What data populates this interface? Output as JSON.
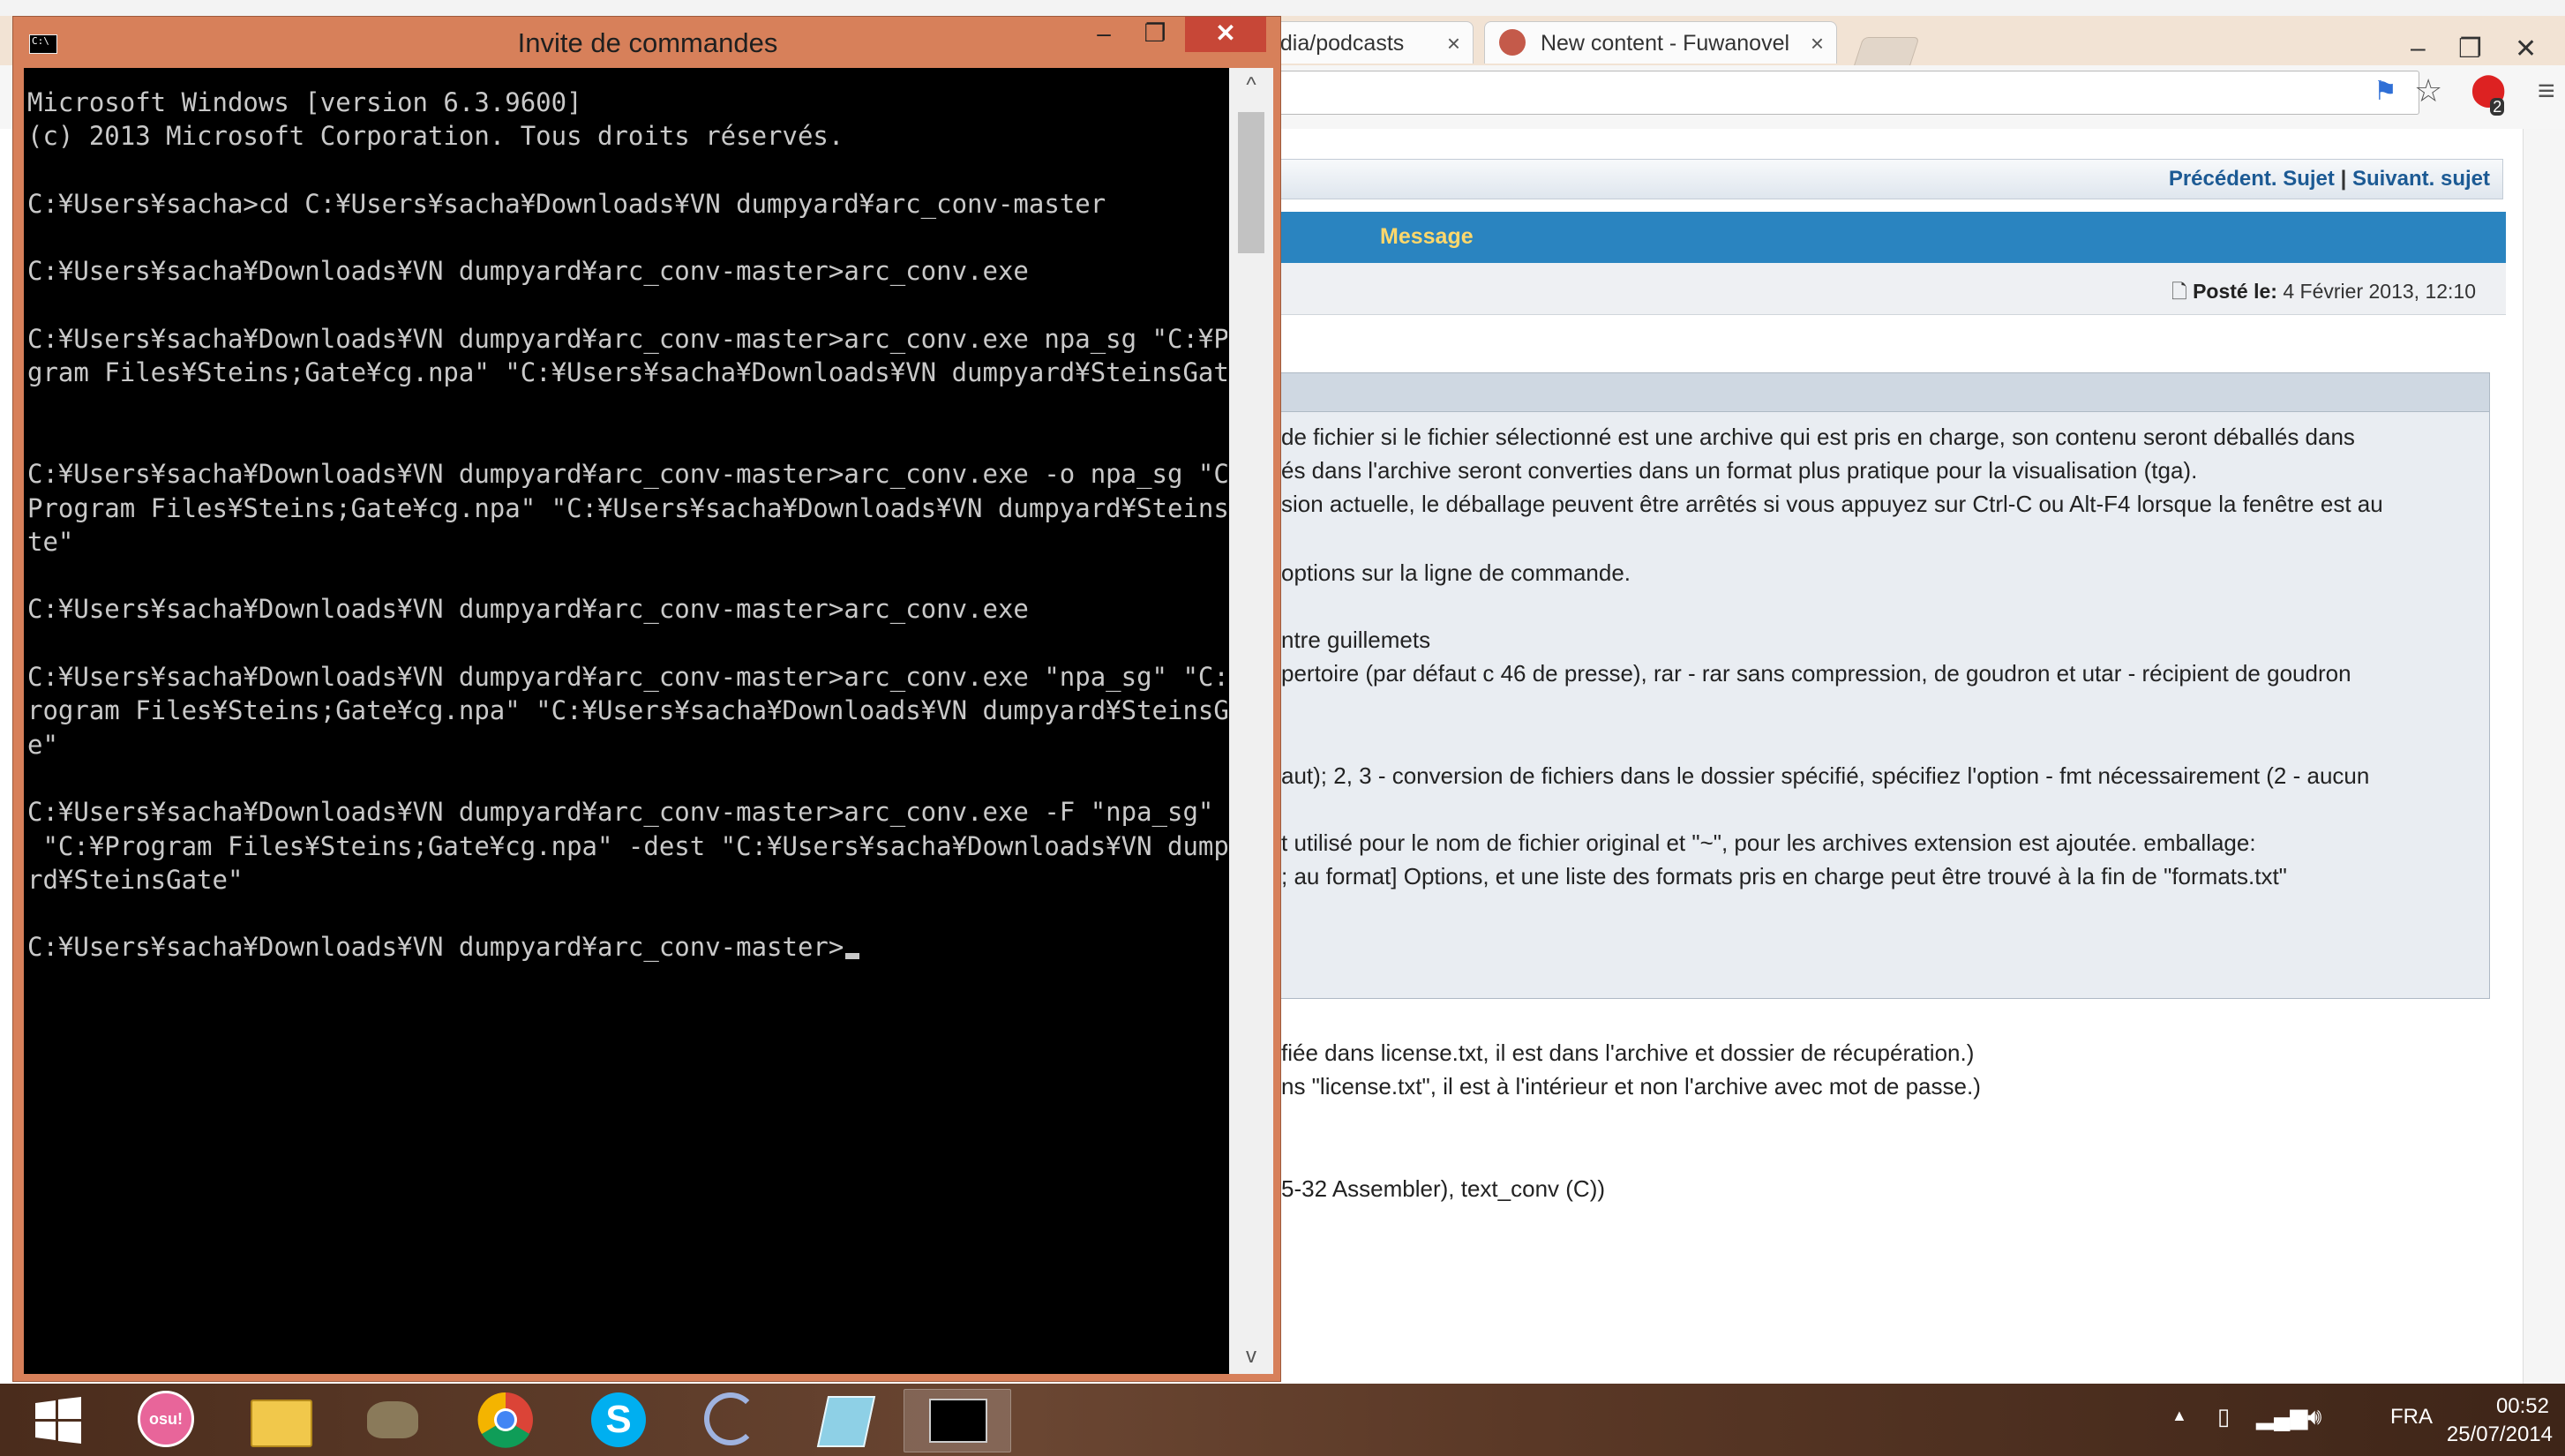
{
  "browser": {
    "tabs": [
      {
        "label": "edia/podcasts",
        "close": "×"
      },
      {
        "label": "New content - Fuwanovel",
        "close": "×"
      }
    ],
    "window_controls": {
      "minimize": "–",
      "maximize": "❐",
      "close": "✕"
    },
    "toolbar_icons": [
      "translate-icon",
      "star-icon",
      "opera-badge-icon",
      "menu-icon"
    ],
    "opera_badge_count": "2",
    "forum": {
      "nav_prev": "Précédent. Sujet",
      "nav_sep": "|",
      "nav_next": "Suivant. sujet",
      "message_header": "Message",
      "posted_label": "Posté le:",
      "posted_date": "4 Février 2013, 12:10",
      "lines": [
        "de fichier si le fichier sélectionné est une archive qui est pris en charge, son contenu seront déballés dans",
        "és dans l'archive seront converties dans un format plus pratique pour la visualisation (tga).",
        "sion actuelle, le déballage peuvent être arrêtés si vous appuyez sur Ctrl-C ou Alt-F4 lorsque la fenêtre est au",
        "options sur la ligne de commande.",
        "ntre guillemets",
        "pertoire (par défaut c 46 de presse), rar - rar sans compression, de goudron et utar - récipient de goudron",
        "aut); 2, 3 - conversion de fichiers dans le dossier spécifié, spécifiez l'option - fmt nécessairement (2 - aucun",
        "t utilisé pour le nom de fichier original et \"~\", pour les archives extension est ajoutée. emballage:",
        "; au format] Options, et une liste des formats pris en charge peut être trouvé à la fin de \"formats.txt\"",
        "fiée dans license.txt, il est dans l'archive et dossier de récupération.)",
        "ns \"license.txt\", il est à l'intérieur et non l'archive avec mot de passe.)",
        "5-32 Assembler), text_conv (C))"
      ]
    }
  },
  "cmd": {
    "title": "Invite de commandes",
    "controls": {
      "minimize": "–",
      "maximize": "❐",
      "close": "✕"
    },
    "console_text": "Microsoft Windows [version 6.3.9600]\n(c) 2013 Microsoft Corporation. Tous droits réservés.\n\nC:¥Users¥sacha>cd C:¥Users¥sacha¥Downloads¥VN dumpyard¥arc_conv-master\n\nC:¥Users¥sacha¥Downloads¥VN dumpyard¥arc_conv-master>arc_conv.exe\n\nC:¥Users¥sacha¥Downloads¥VN dumpyard¥arc_conv-master>arc_conv.exe npa_sg \"C:¥Pro\ngram Files¥Steins;Gate¥cg.npa\" \"C:¥Users¥sacha¥Downloads¥VN dumpyard¥SteinsGate\"\n\n\nC:¥Users¥sacha¥Downloads¥VN dumpyard¥arc_conv-master>arc_conv.exe -o npa_sg \"C:¥\nProgram Files¥Steins;Gate¥cg.npa\" \"C:¥Users¥sacha¥Downloads¥VN dumpyard¥SteinsGa\nte\"\n\nC:¥Users¥sacha¥Downloads¥VN dumpyard¥arc_conv-master>arc_conv.exe\n\nC:¥Users¥sacha¥Downloads¥VN dumpyard¥arc_conv-master>arc_conv.exe \"npa_sg\" \"C:¥P\nrogram Files¥Steins;Gate¥cg.npa\" \"C:¥Users¥sacha¥Downloads¥VN dumpyard¥SteinsGat\ne\"\n\nC:¥Users¥sacha¥Downloads¥VN dumpyard¥arc_conv-master>arc_conv.exe -F \"npa_sg\" -o\n \"C:¥Program Files¥Steins;Gate¥cg.npa\" -dest \"C:¥Users¥sacha¥Downloads¥VN dumpya\nrd¥SteinsGate\"\n\nC:¥Users¥sacha¥Downloads¥VN dumpyard¥arc_conv-master>",
    "scroll_up": "^",
    "scroll_down": "v"
  },
  "taskbar": {
    "apps": [
      "windows-start",
      "osu",
      "file-explorer",
      "gimp",
      "chrome",
      "skype",
      "torrent",
      "notepad",
      "cmd"
    ],
    "osu_label": "osu!",
    "skype_label": "S",
    "language": "FRA",
    "time": "00:52",
    "date": "25/07/2014"
  }
}
